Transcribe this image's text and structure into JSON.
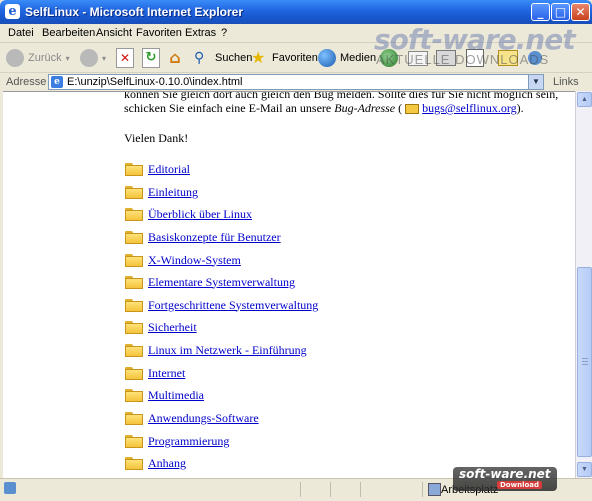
{
  "window": {
    "title": "SelfLinux - Microsoft Internet Explorer"
  },
  "menu": [
    "Datei",
    "Bearbeiten",
    "Ansicht",
    "Favoriten",
    "Extras",
    "?"
  ],
  "toolbar": {
    "back": "Zurück",
    "search": "Suchen",
    "favorites": "Favoriten",
    "media": "Medien"
  },
  "address": {
    "label": "Adresse",
    "url": "E:\\unzip\\SelfLinux-0.10.0\\index.html",
    "links": "Links"
  },
  "content": {
    "line1": "können Sie gleich dort auch gleich den Bug melden. Sollte dies für Sie nicht möglich sein,",
    "line2_pre": "schicken Sie einfach eine E-Mail an unsere ",
    "line2_em": "Bug-Adresse",
    "line2_paren": " ( ",
    "email": "bugs@selflinux.org",
    "line2_post": ").",
    "thanks": "Vielen Dank!",
    "items": [
      "Editorial",
      "Einleitung",
      "Überblick über Linux",
      "Basiskonzepte für Benutzer",
      "X-Window-System",
      "Elementare Systemverwaltung",
      "Fortgeschrittene Systemverwaltung",
      "Sicherheit",
      "Linux im Netzwerk - Einführung",
      "Internet",
      "Multimedia",
      "Anwendungs-Software",
      "Programmierung",
      "Anhang"
    ]
  },
  "status": {
    "zone": "Arbeitsplatz"
  },
  "watermark": {
    "brand": "soft-ware.net",
    "tagline": "AKTUELLE DOWNLOADS",
    "badge": "Download"
  }
}
